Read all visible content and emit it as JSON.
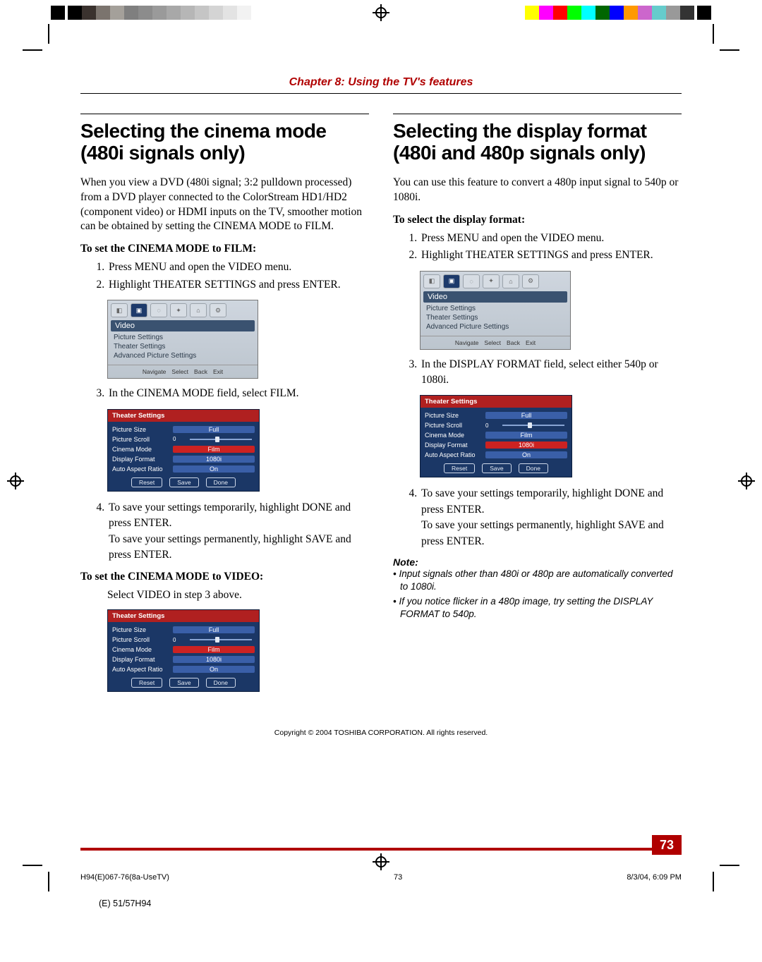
{
  "chapter": "Chapter 8: Using the TV's features",
  "left": {
    "h1": "Selecting the cinema mode (480i signals only)",
    "intro": "When you view a DVD (480i signal; 3:2 pulldown processed) from a DVD player connected to the ColorStream HD1/HD2 (component video) or HDMI inputs on the TV, smoother motion can be obtained by setting the CINEMA MODE to FILM.",
    "sub1": "To set the CINEMA MODE to FILM:",
    "steps1": {
      "a": "Press MENU and open the VIDEO menu.",
      "b": "Highlight THEATER SETTINGS and press ENTER."
    },
    "step3": "In the CINEMA MODE field, select FILM.",
    "step4a": "To save your settings temporarily, highlight DONE and press ENTER.",
    "step4b": "To save your settings permanently, highlight SAVE and press ENTER.",
    "sub2": "To set the CINEMA MODE to VIDEO:",
    "sub2_body": "Select VIDEO in step 3 above."
  },
  "right": {
    "h1": "Selecting the display format (480i and 480p signals only)",
    "intro": "You can use this feature to convert a 480p input signal to 540p or 1080i.",
    "sub1": "To select the display format:",
    "steps1": {
      "a": "Press MENU and open the VIDEO menu.",
      "b": "Highlight THEATER SETTINGS and press ENTER."
    },
    "step3": "In the DISPLAY FORMAT field, select either 540p or 1080i.",
    "step4a": "To save your settings temporarily, highlight DONE and press ENTER.",
    "step4b": "To save your settings permanently, highlight SAVE and press ENTER.",
    "note_head": "Note:",
    "notes": {
      "a": "Input signals other than 480i or 480p are automatically converted to 1080i.",
      "b": "If you notice flicker in a 480p image, try setting the DISPLAY FORMAT to 540p."
    }
  },
  "osd": {
    "label": "Video",
    "items": {
      "a": "Picture Settings",
      "b": "Theater Settings",
      "c": "Advanced Picture Settings"
    },
    "hints": {
      "nav": "Navigate",
      "sel": "Select",
      "back": "Back",
      "exit": "Exit"
    }
  },
  "theater": {
    "header": "Theater Settings",
    "picture_size_k": "Picture Size",
    "picture_size_v": "Full",
    "picture_scroll_k": "Picture Scroll",
    "cinema_mode_k": "Cinema Mode",
    "cinema_mode_v": "Film",
    "display_format_k": "Display Format",
    "display_format_v": "1080i",
    "auto_aspect_k": "Auto Aspect Ratio",
    "auto_aspect_v": "On",
    "btn_reset": "Reset",
    "btn_save": "Save",
    "btn_done": "Done"
  },
  "copyright": "Copyright © 2004 TOSHIBA CORPORATION. All rights reserved.",
  "pagenum": "73",
  "footer": {
    "file": "H94(E)067-76(8a-UseTV)",
    "page": "73",
    "date": "8/3/04, 6:09 PM",
    "cut": "(E) 51/57H94"
  },
  "colors": {
    "bar1": [
      "#000000",
      "#3a322e",
      "#7b746e",
      "#a4a09a",
      "#7f7f7f",
      "#8c8c8c",
      "#9a9a9a",
      "#a8a8a8",
      "#b6b6b6",
      "#c5c5c5",
      "#d4d4d4",
      "#e3e3e3",
      "#f2f2f2",
      "#ffffff"
    ],
    "bar2": [
      "#ffff00",
      "#ff00ff",
      "#ff0000",
      "#00ff00",
      "#00ffff",
      "#006600",
      "#0000ff",
      "#ff9900",
      "#cc66cc",
      "#66cccc",
      "#999999",
      "#333333"
    ]
  }
}
